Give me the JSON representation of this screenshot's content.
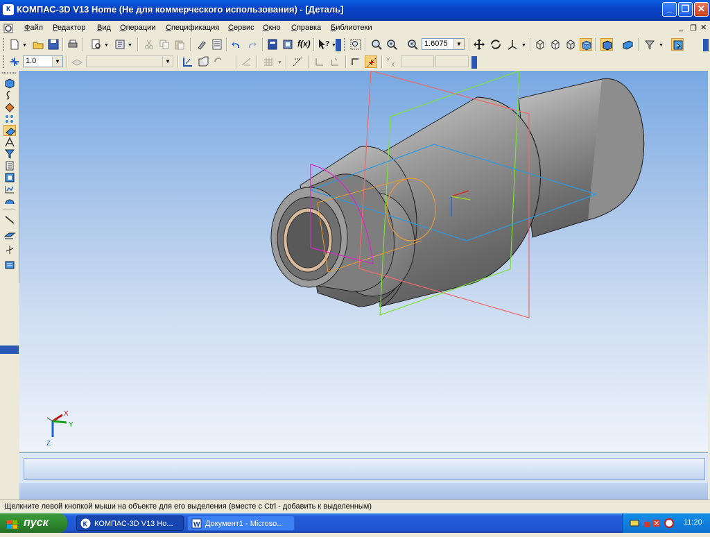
{
  "window": {
    "title": "КОМПАС-3D V13 Home (Не для коммерческого использования) - [Деталь]",
    "app_icon": "К"
  },
  "menu": {
    "items": [
      {
        "label": "Файл",
        "ul": "Ф",
        "rest": "айл"
      },
      {
        "label": "Редактор",
        "ul": "Р",
        "rest": "едактор"
      },
      {
        "label": "Вид",
        "ul": "В",
        "rest": "ид"
      },
      {
        "label": "Операции",
        "ul": "О",
        "rest": "перации"
      },
      {
        "label": "Спецификация",
        "ul": "С",
        "rest": "пецификация"
      },
      {
        "label": "Сервис",
        "ul": "С",
        "rest": "ервис"
      },
      {
        "label": "Окно",
        "ul": "О",
        "rest": "кно"
      },
      {
        "label": "Справка",
        "ul": "С",
        "rest": "правка"
      },
      {
        "label": "Библиотеки",
        "ul": "Б",
        "rest": "иблиотеки"
      }
    ]
  },
  "toolbar": {
    "zoom_value": "1.6075",
    "step_value": "1.0"
  },
  "viewport": {
    "axes": {
      "x": "X",
      "y": "Y",
      "z": "Z"
    },
    "colors": {
      "plane_red": "#ee6a6a",
      "plane_green": "#7ddf3a",
      "plane_blue": "#2a9ae0",
      "sketch_magenta": "#d828c8",
      "sketch_orange": "#e89a38",
      "part_body": "#8a8a8a"
    }
  },
  "status": {
    "hint": "Щелкните левой кнопкой мыши на объекте для его выделения (вместе с Ctrl - добавить к выделенным)"
  },
  "taskbar": {
    "start_label": "пуск",
    "tasks": [
      {
        "label": "КОМПАС-3D V13 Но...",
        "icon": "kompas-icon",
        "active": true
      },
      {
        "label": "Документ1 - Microso...",
        "icon": "word-icon",
        "active": false
      }
    ],
    "clock": "11:20"
  }
}
